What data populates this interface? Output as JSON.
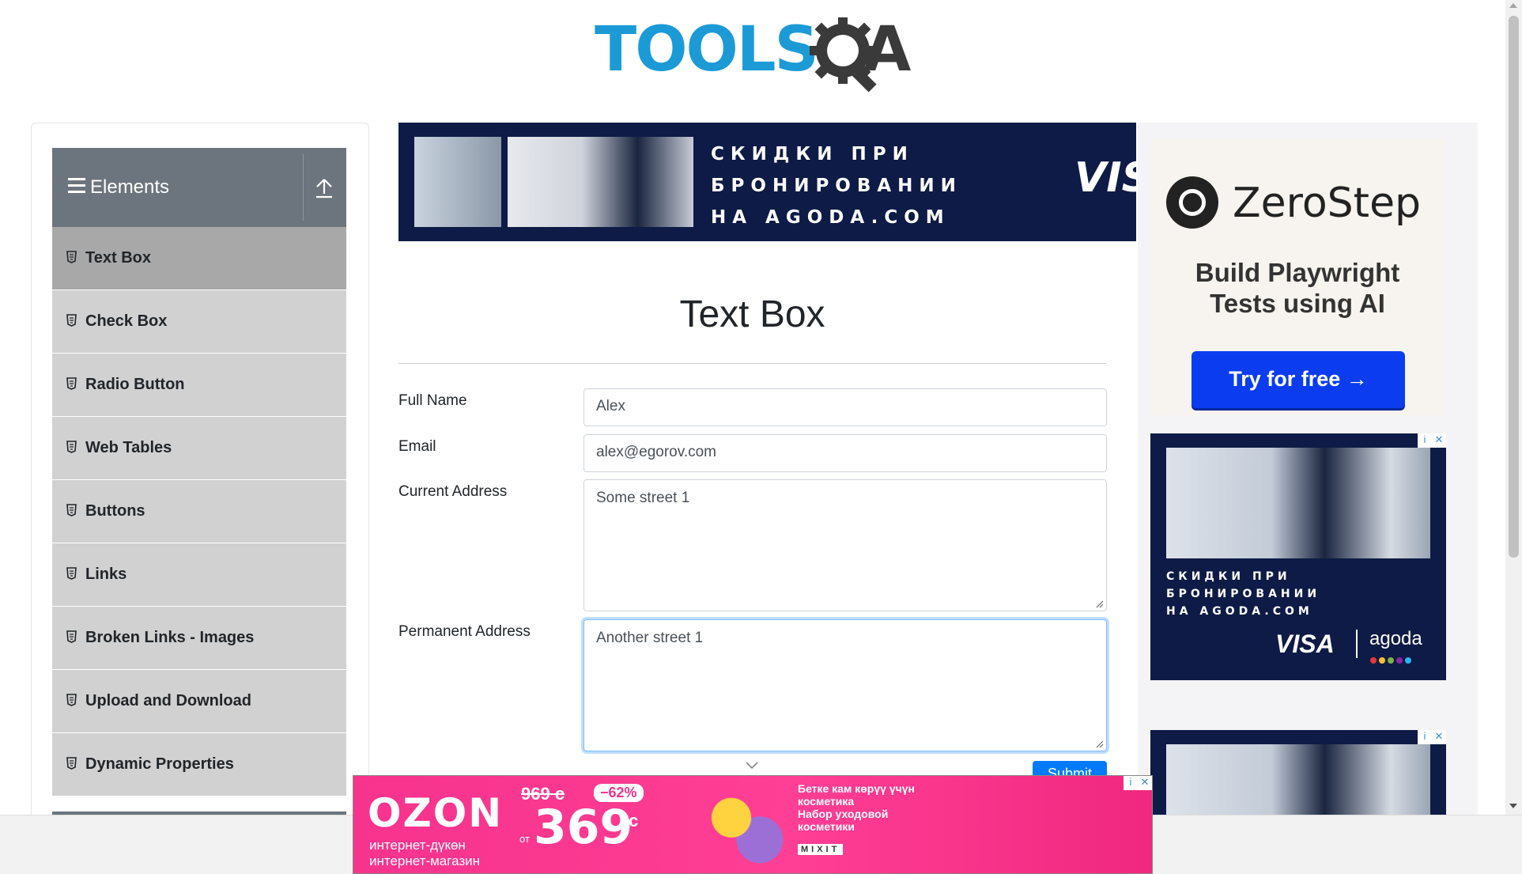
{
  "header": {
    "logo_text": "TOOLS",
    "logo_suffix": "A"
  },
  "sidebar": {
    "group_title": "Elements",
    "items": [
      {
        "label": "Text Box",
        "active": true
      },
      {
        "label": "Check Box"
      },
      {
        "label": "Radio Button"
      },
      {
        "label": "Web Tables"
      },
      {
        "label": "Buttons"
      },
      {
        "label": "Links"
      },
      {
        "label": "Broken Links - Images"
      },
      {
        "label": "Upload and Download"
      },
      {
        "label": "Dynamic Properties"
      }
    ]
  },
  "top_ad": {
    "lines": [
      "СКИДКИ ПРИ",
      "БРОНИРОВАНИИ",
      "НА AGODA.COM"
    ],
    "brand": "VIS"
  },
  "main": {
    "title": "Text Box",
    "form": {
      "full_name_label": "Full Name",
      "full_name_value": "Alex",
      "email_label": "Email",
      "email_value": "alex@egorov.com",
      "current_address_label": "Current Address",
      "current_address_value": "Some street 1",
      "permanent_address_label": "Permanent Address",
      "permanent_address_value": "Another street 1",
      "submit_label": "Submit"
    }
  },
  "right_ads": {
    "zerostep": {
      "name": "ZeroStep",
      "tagline_1": "Build Playwright",
      "tagline_2": "Tests using AI",
      "cta": "Try for free →"
    },
    "agoda": {
      "lines": [
        "СКИДКИ ПРИ",
        "БРОНИРОВАНИИ",
        "НА AGODA.COM"
      ],
      "visa": "VISA",
      "agoda": "agoda"
    },
    "ad_info": "i",
    "ad_close": "✕"
  },
  "bottom_ad": {
    "brand": "OZON",
    "sub_1": "интернет-дүкөн",
    "sub_2": "интернет-магазин",
    "old_price": "969 с",
    "discount": "−62%",
    "from": "от",
    "price": "369",
    "currency": "с",
    "desc_1": "Бетке кам көрүү үчүн",
    "desc_2": "косметика",
    "desc_3": "Набор уходовой",
    "desc_4": "косметики",
    "mixit": "MIXIT"
  },
  "colors": {
    "accent": "#007bff",
    "sidebar_header": "#6c757d",
    "menu_item": "#d1d1d1",
    "menu_active": "#a8a8a8",
    "logo_blue": "#1c9ad6"
  }
}
